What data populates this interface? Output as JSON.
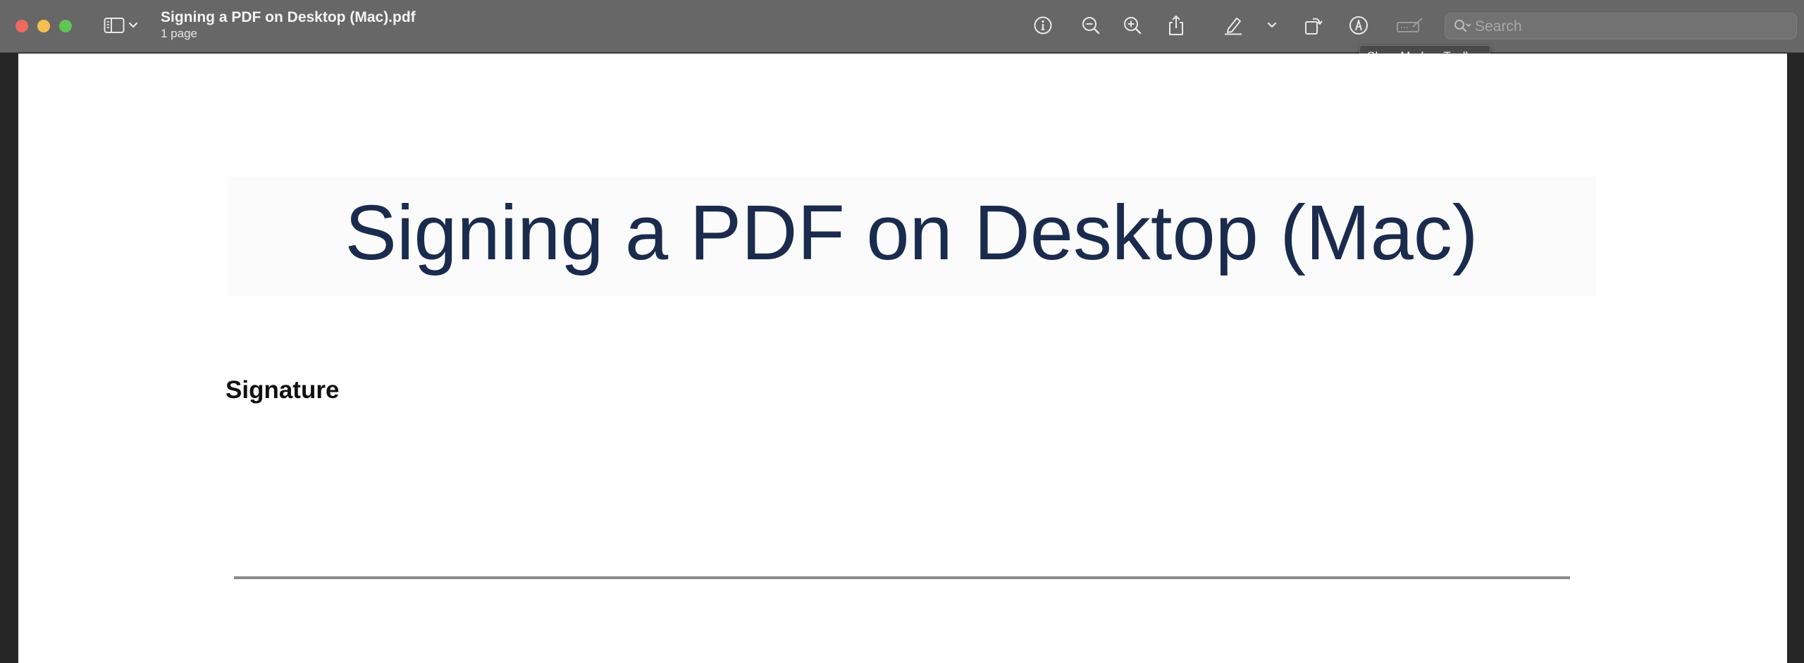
{
  "window": {
    "title": "Signing a PDF on Desktop (Mac).pdf",
    "subtitle": "1 page"
  },
  "toolbar": {
    "buttons": [
      {
        "name": "sidebar-toggle",
        "icon": "sidebar-icon"
      },
      {
        "name": "view-menu",
        "icon": "chevron-down-icon"
      },
      {
        "name": "info",
        "icon": "info-icon"
      },
      {
        "name": "zoom-out",
        "icon": "zoom-out-icon"
      },
      {
        "name": "zoom-in",
        "icon": "zoom-in-icon"
      },
      {
        "name": "share",
        "icon": "share-icon"
      },
      {
        "name": "highlight",
        "icon": "highlighter-icon"
      },
      {
        "name": "highlight-menu",
        "icon": "chevron-down-icon"
      },
      {
        "name": "rotate",
        "icon": "rotate-icon"
      },
      {
        "name": "markup",
        "icon": "markup-pen-icon"
      },
      {
        "name": "form-filling",
        "icon": "form-fill-icon"
      }
    ],
    "search_placeholder": "Search",
    "tooltip": "Show Markup Toolbar"
  },
  "document": {
    "heading": "Signing a PDF on Desktop (Mac)",
    "signature_label": "Signature"
  },
  "colors": {
    "toolbar_bg": "#676767",
    "heading_text": "#1b2b4d",
    "signature_line": "#8a8a8a",
    "close": "#ed6a5e",
    "minimize": "#f5bf4f",
    "maximize": "#61c554"
  }
}
